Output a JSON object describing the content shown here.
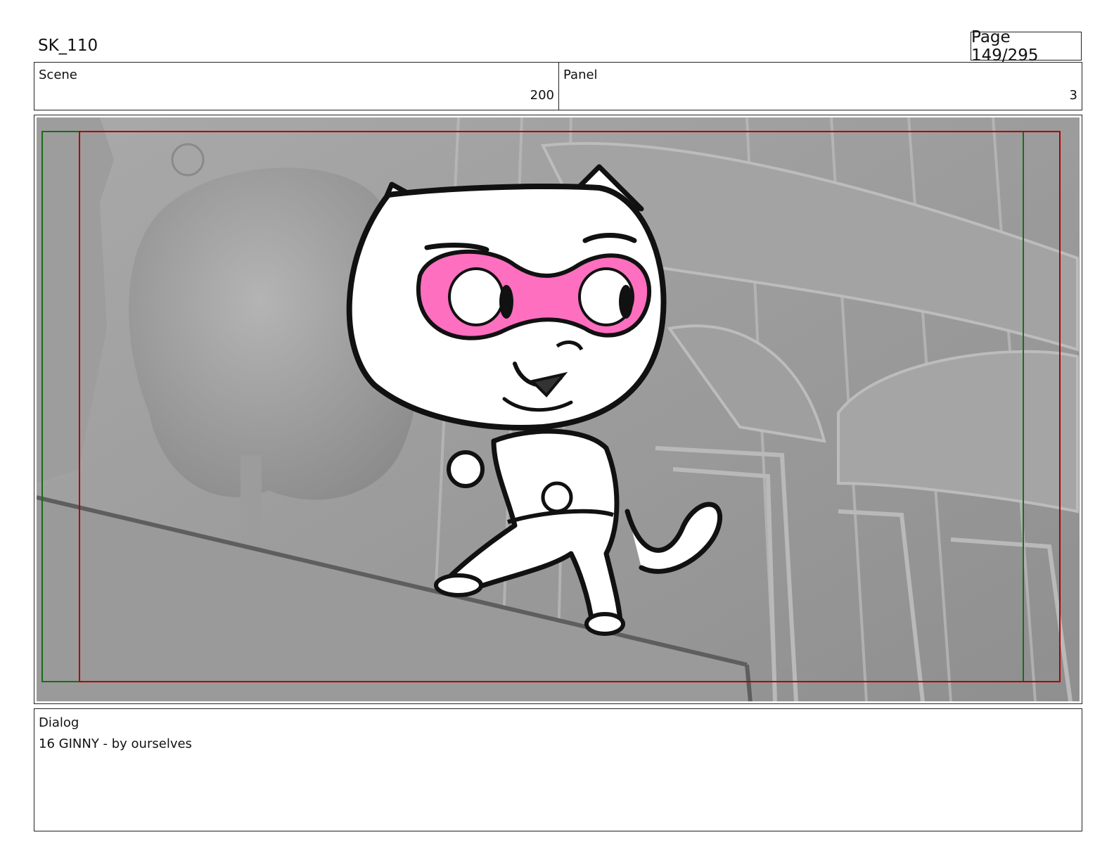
{
  "header": {
    "project": "SK_110",
    "page": "Page 149/295"
  },
  "info": {
    "scene_label": "Scene",
    "scene_value": "200",
    "panel_label": "Panel",
    "panel_value": "3"
  },
  "frame": {
    "icon": "storyboard-frame-cat-sketch",
    "safe_area_color": "#b00000",
    "action_area_color": "#1a6b1a",
    "mask_color": "#ff6fc0"
  },
  "dialog": {
    "label": "Dialog",
    "text": "16 GINNY - by ourselves"
  }
}
